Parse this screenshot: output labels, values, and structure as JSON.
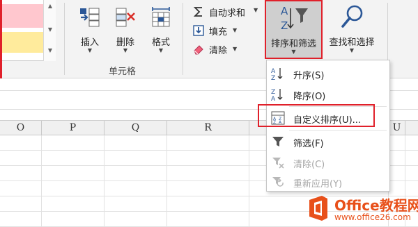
{
  "ribbon": {
    "cells_group": {
      "label": "单元格",
      "insert": "插入",
      "delete": "删除",
      "format": "格式"
    },
    "editing": {
      "autosum": "自动求和",
      "fill": "填充",
      "clear": "清除",
      "sort_filter": "排序和筛选",
      "find_select": "查找和选择"
    }
  },
  "columns": [
    "O",
    "P",
    "Q",
    "R",
    "U"
  ],
  "sort_menu": {
    "items": [
      {
        "label": "升序(S)",
        "icon": "sort-ascending-icon",
        "enabled": true
      },
      {
        "label": "降序(O)",
        "icon": "sort-descending-icon",
        "enabled": true
      },
      {
        "label": "自定义排序(U)...",
        "icon": "custom-sort-icon",
        "enabled": true
      },
      {
        "label": "筛选(F)",
        "icon": "filter-icon",
        "enabled": true
      },
      {
        "label": "清除(C)",
        "icon": "clear-filter-icon",
        "enabled": false
      },
      {
        "label": "重新应用(Y)",
        "icon": "reapply-filter-icon",
        "enabled": false
      }
    ]
  },
  "watermark": {
    "title": "Office教程网",
    "url": "www.office26.com"
  },
  "colors": {
    "highlight_red": "#e0202a",
    "ribbon_bg": "#f3f3f3",
    "pressed_bg": "#cfcfcf",
    "accent_blue": "#2b5797",
    "watermark_orange": "#e8501a"
  }
}
